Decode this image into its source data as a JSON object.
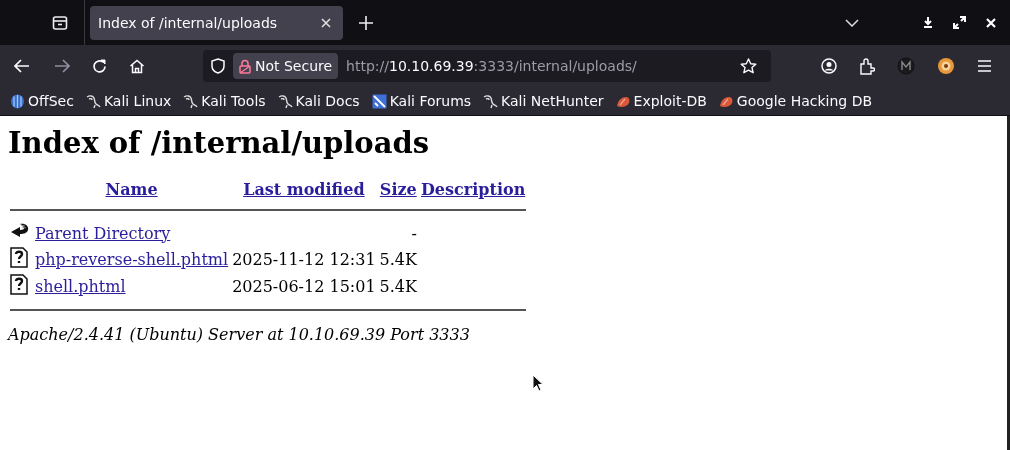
{
  "tab": {
    "title": "Index of /internal/uploads",
    "selected": true
  },
  "address": {
    "security": "Not Secure",
    "scheme": "http://",
    "host": "10.10.69.39",
    "rest": ":3333/internal/uploads/"
  },
  "bookmarks": [
    {
      "label": "OffSec",
      "kind": "offsec"
    },
    {
      "label": "Kali Linux",
      "kind": "kali"
    },
    {
      "label": "Kali Tools",
      "kind": "kali"
    },
    {
      "label": "Kali Docs",
      "kind": "kali"
    },
    {
      "label": "Kali Forums",
      "kind": "forums"
    },
    {
      "label": "Kali NetHunter",
      "kind": "kali"
    },
    {
      "label": "Exploit-DB",
      "kind": "exploit"
    },
    {
      "label": "Google Hacking DB",
      "kind": "exploit"
    }
  ],
  "page": {
    "heading": "Index of /internal/uploads",
    "columns": [
      "Name",
      "Last modified",
      "Size",
      "Description"
    ],
    "rows": [
      {
        "kind": "parent",
        "name": "Parent Directory",
        "modified": "",
        "size": "-"
      },
      {
        "kind": "file",
        "name": "php-reverse-shell.phtml",
        "modified": "2025-11-12 12:31",
        "size": "5.4K"
      },
      {
        "kind": "file",
        "name": "shell.phtml",
        "modified": "2025-06-12 15:01",
        "size": "5.4K"
      }
    ],
    "footer": "Apache/2.4.41 (Ubuntu) Server at 10.10.69.39 Port 3333"
  }
}
